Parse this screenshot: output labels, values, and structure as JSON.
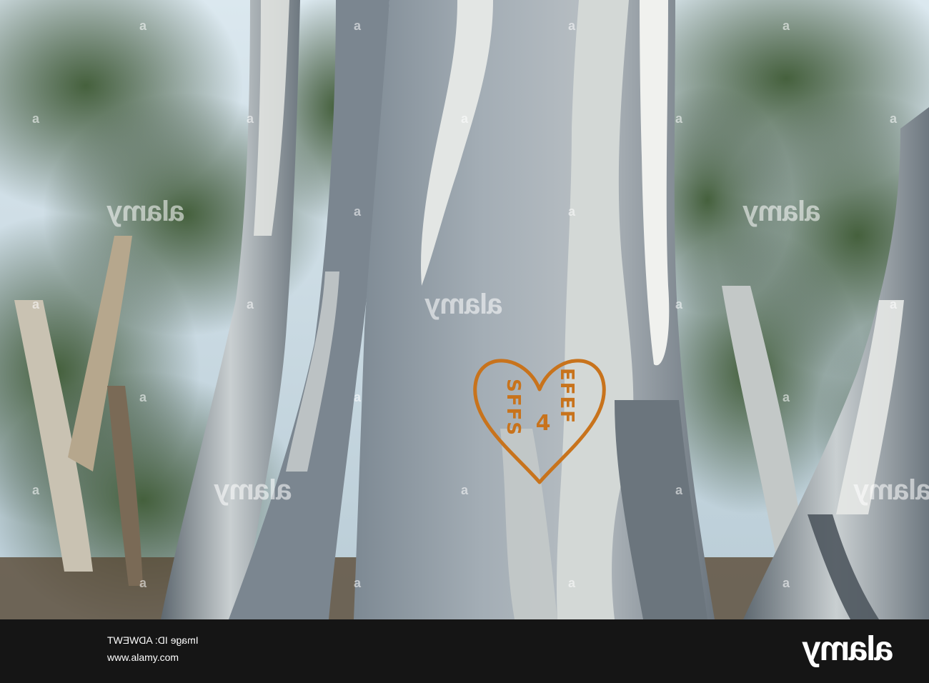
{
  "scene": {
    "subject": "carved-heart-on-eucalyptus-trunk",
    "colors": {
      "sky": "#cfe0ea",
      "foliage_dark": "#27402a",
      "foliage_mid": "#4d6a3f",
      "bark_grey": "#8a96a0",
      "bark_light": "#dfe3e2",
      "bark_dark": "#5a636b",
      "carving": "#c8731c",
      "ground": "#6b5840"
    }
  },
  "carving": {
    "left_text": "SFFS",
    "right_text": "EFEF",
    "center_text": "4"
  },
  "watermark": {
    "text": "alamy",
    "mark": "a"
  },
  "footer": {
    "image_id_line": "Image ID: ADWEWT",
    "url_line": "www.alamy.com",
    "logo_text": "alamy",
    "background": "#151515"
  }
}
